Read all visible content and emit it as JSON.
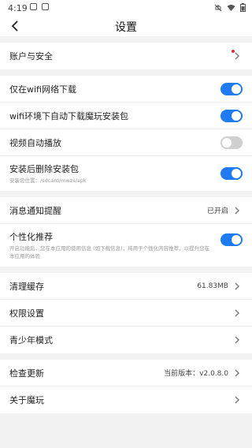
{
  "status": {
    "time": "4:19"
  },
  "header": {
    "title": "设置"
  },
  "colors": {
    "accent": "#1e7bf2",
    "toggle_off": "#cfcfcf",
    "badge": "#e0302d"
  },
  "sections": {
    "account": {
      "label": "账户与安全"
    },
    "download": {
      "wifi_only": {
        "label": "仅在wifi网络下载",
        "enabled": true
      },
      "auto_download": {
        "label": "wifi环境下自动下载魔玩安装包",
        "enabled": true
      },
      "video_autoplay": {
        "label": "视频自动播放",
        "enabled": false
      },
      "delete_after_install": {
        "label": "安装后删除安装包",
        "sub": "安装包位置：/sdcard/mwzs/apk",
        "enabled": true
      }
    },
    "notify": {
      "message": {
        "label": "消息通知提醒",
        "value": "已开启"
      },
      "personal": {
        "label": "个性化推荐",
        "sub": "开启功能后，您在本应用的使用信息 (如下载信息)，将用于个性化内容推荐，以提升您在本应用的体验",
        "enabled": true
      }
    },
    "misc": {
      "cache": {
        "label": "清理缓存",
        "value": "61.83MB"
      },
      "permission": {
        "label": "权限设置"
      },
      "teen": {
        "label": "青少年模式"
      }
    },
    "about": {
      "update": {
        "label": "检查更新",
        "value": "当前版本：v2.0.8.0"
      },
      "about": {
        "label": "关于魔玩"
      }
    }
  }
}
